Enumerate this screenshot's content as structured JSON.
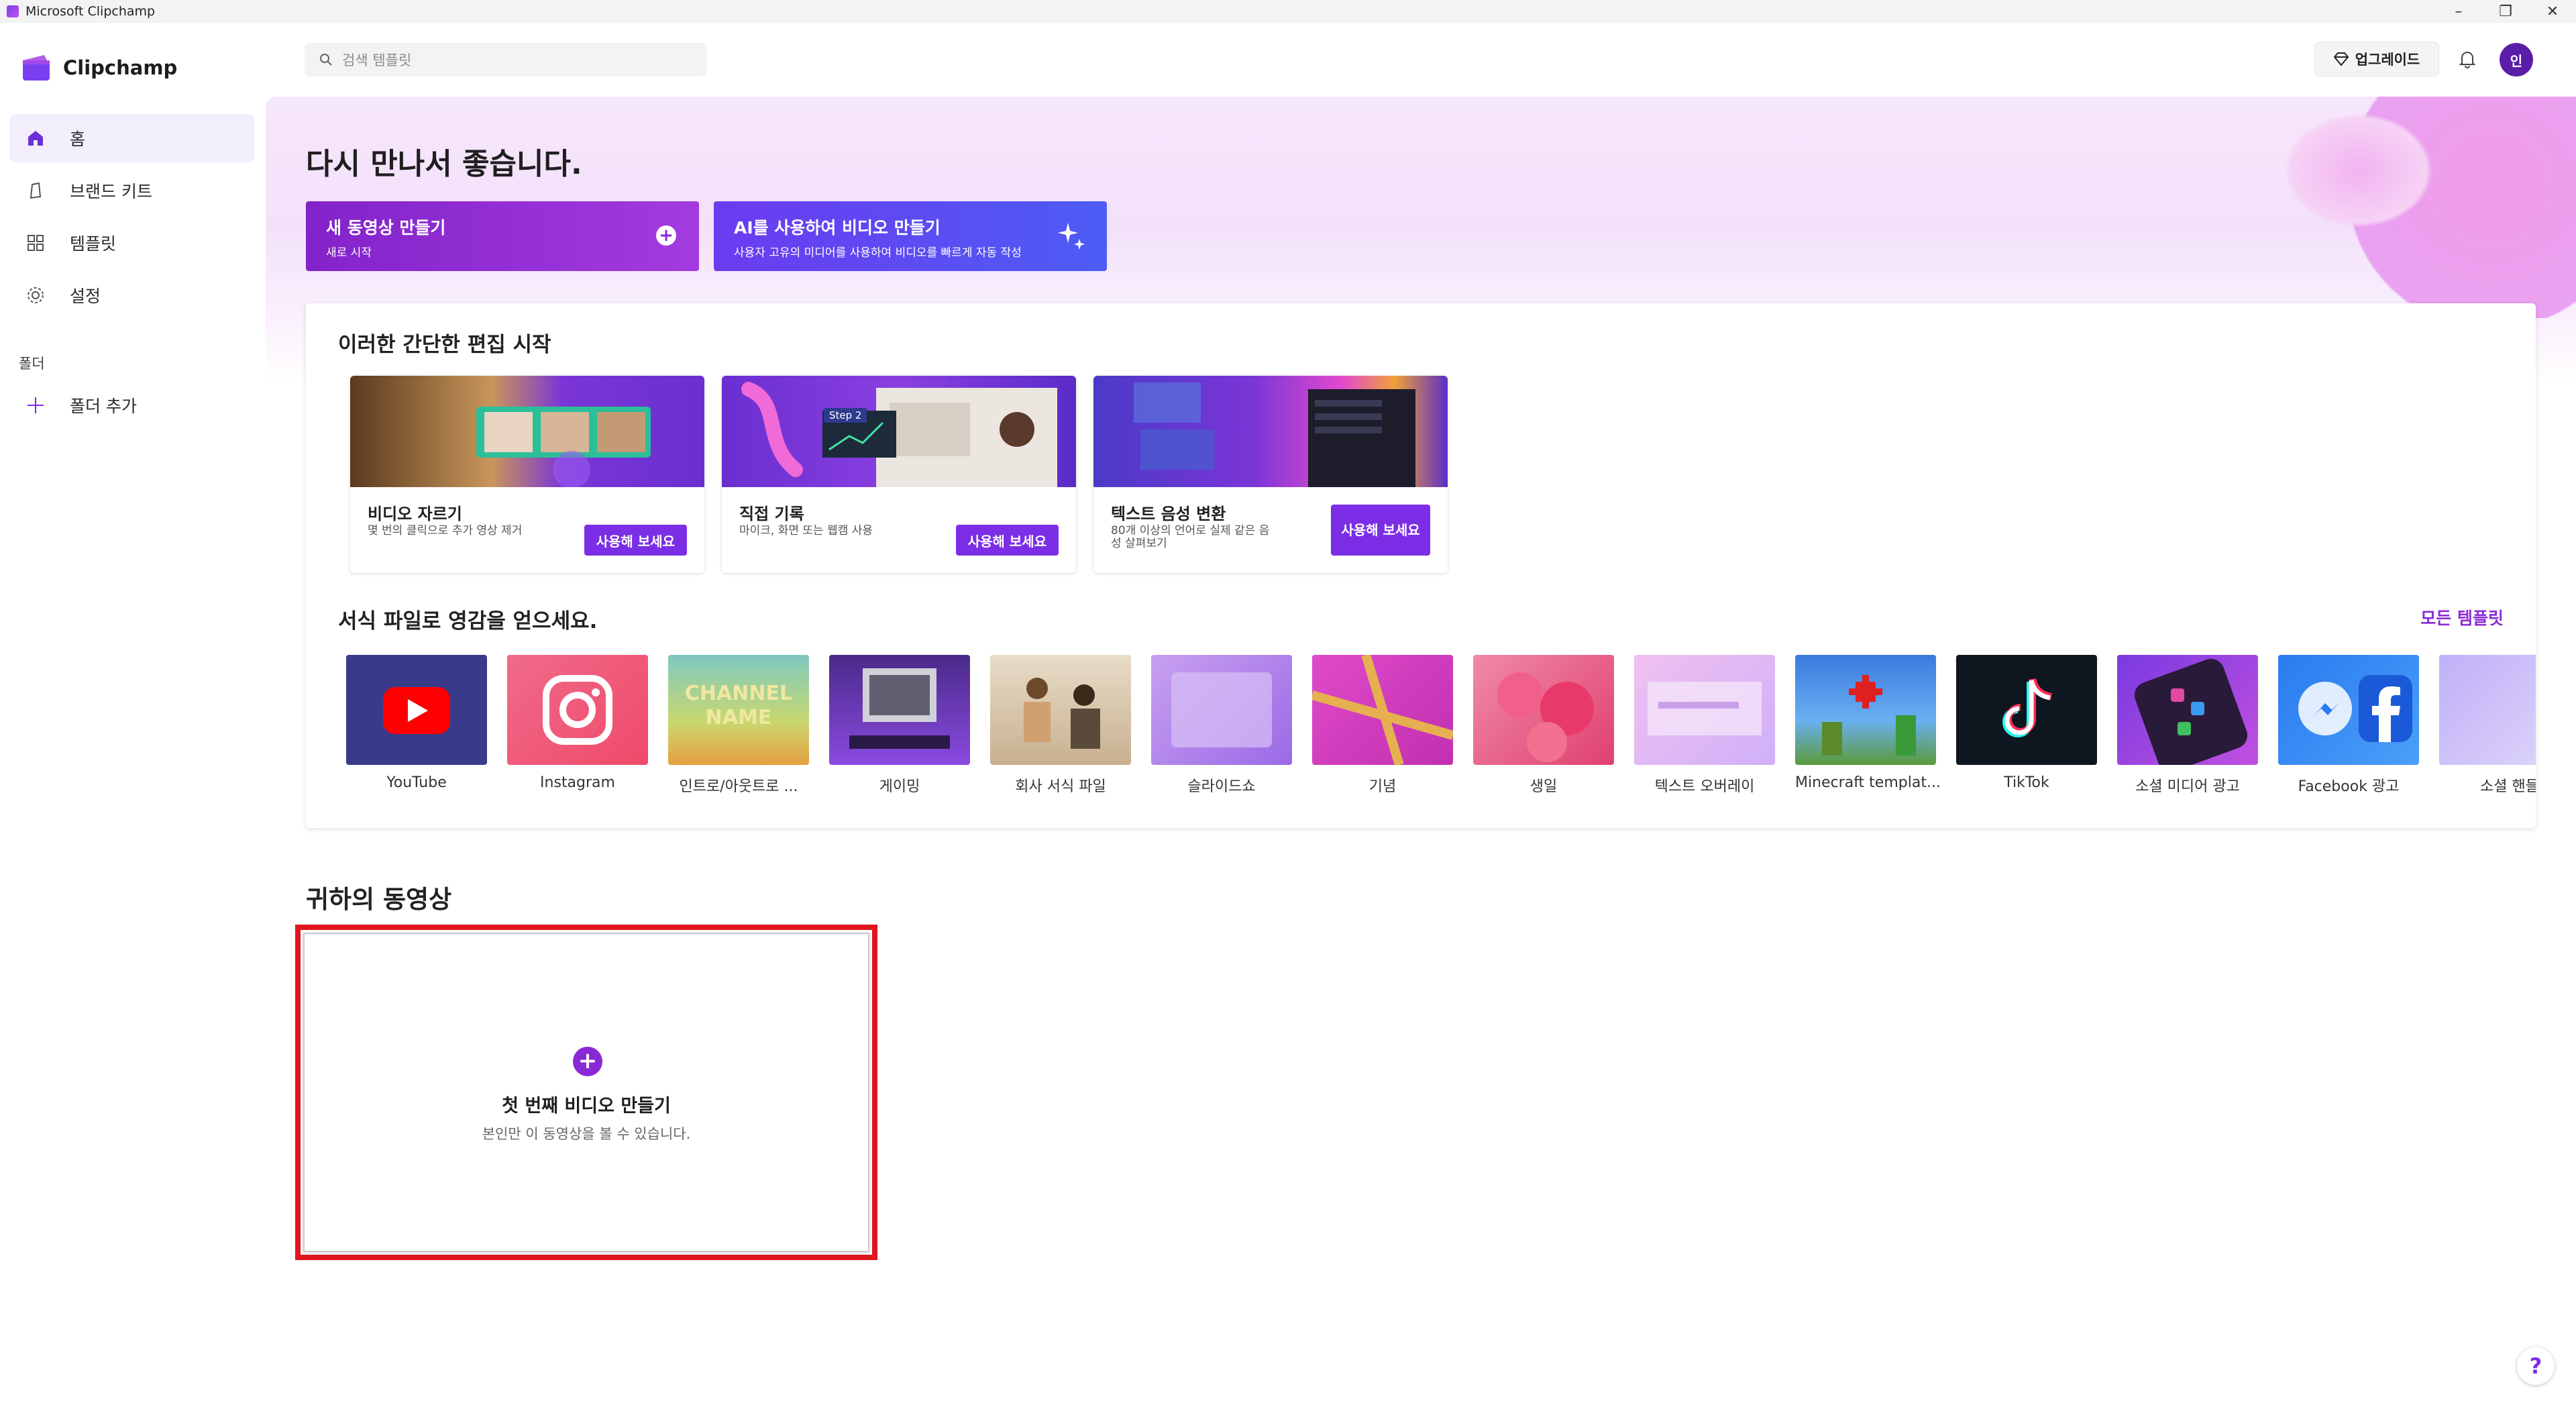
{
  "window": {
    "title": "Microsoft Clipchamp",
    "controls": [
      "–",
      "❐",
      "✕"
    ]
  },
  "brand": {
    "name": "Clipchamp"
  },
  "sidebar": {
    "items": [
      {
        "label": "홈",
        "icon": "home-icon"
      },
      {
        "label": "브랜드 키트",
        "icon": "brand-kit-icon"
      },
      {
        "label": "템플릿",
        "icon": "templates-icon"
      },
      {
        "label": "설정",
        "icon": "settings-icon"
      }
    ],
    "folder_heading": "폴더",
    "add_folder_label": "폴더 추가"
  },
  "topbar": {
    "search_placeholder": "검색 템플릿",
    "upgrade_label": "업그레이드",
    "avatar_initial": "인"
  },
  "hero": {
    "welcome": "다시 만나서 좋습니다.",
    "new_video": {
      "title": "새 동영상 만들기",
      "subtitle": "새로 시작"
    },
    "ai_video": {
      "title": "AI를 사용하여 비디오 만들기",
      "subtitle": "사용자 고유의 미디어를 사용하여 비디오를 빠르게 자동 작성"
    }
  },
  "quick_edits": {
    "heading": "이러한 간단한 편집 시작",
    "cards": [
      {
        "title": "비디오 자르기",
        "desc": "몇 번의 클릭으로 추가 영상 제거",
        "button": "사용해 보세요"
      },
      {
        "title": "직접 기록",
        "desc": "마이크, 화면 또는 웹캠 사용",
        "button": "사용해 보세요",
        "badge": "Step 2"
      },
      {
        "title": "텍스트 음성 변환",
        "desc": "80개 이상의 언어로 실제 같은 음성 살펴보기",
        "button": "사용해 보세요"
      }
    ]
  },
  "templates": {
    "heading": "서식 파일로 영감을 얻으세요.",
    "all_link": "모든 템플릿",
    "items": [
      {
        "name": "YouTube"
      },
      {
        "name": "Instagram"
      },
      {
        "name": "인트로/아웃트로 ...",
        "thumb_text": "CHANNEL NAME"
      },
      {
        "name": "게이밍"
      },
      {
        "name": "회사 서식 파일"
      },
      {
        "name": "슬라이드쇼"
      },
      {
        "name": "기념"
      },
      {
        "name": "생일"
      },
      {
        "name": "텍스트 오버레이"
      },
      {
        "name": "Minecraft templat..."
      },
      {
        "name": "TikTok"
      },
      {
        "name": "소셜 미디어 광고"
      },
      {
        "name": "Facebook 광고"
      },
      {
        "name": "소셜 핸들"
      }
    ]
  },
  "your_videos": {
    "heading": "귀하의 동영상",
    "first": {
      "title": "첫 번째 비디오 만들기",
      "subtitle": "본인만 이 동영상을 볼 수 있습니다."
    }
  },
  "help_label": "?",
  "colors": {
    "accent": "#7b2ee6",
    "highlight": "#e0161e"
  }
}
